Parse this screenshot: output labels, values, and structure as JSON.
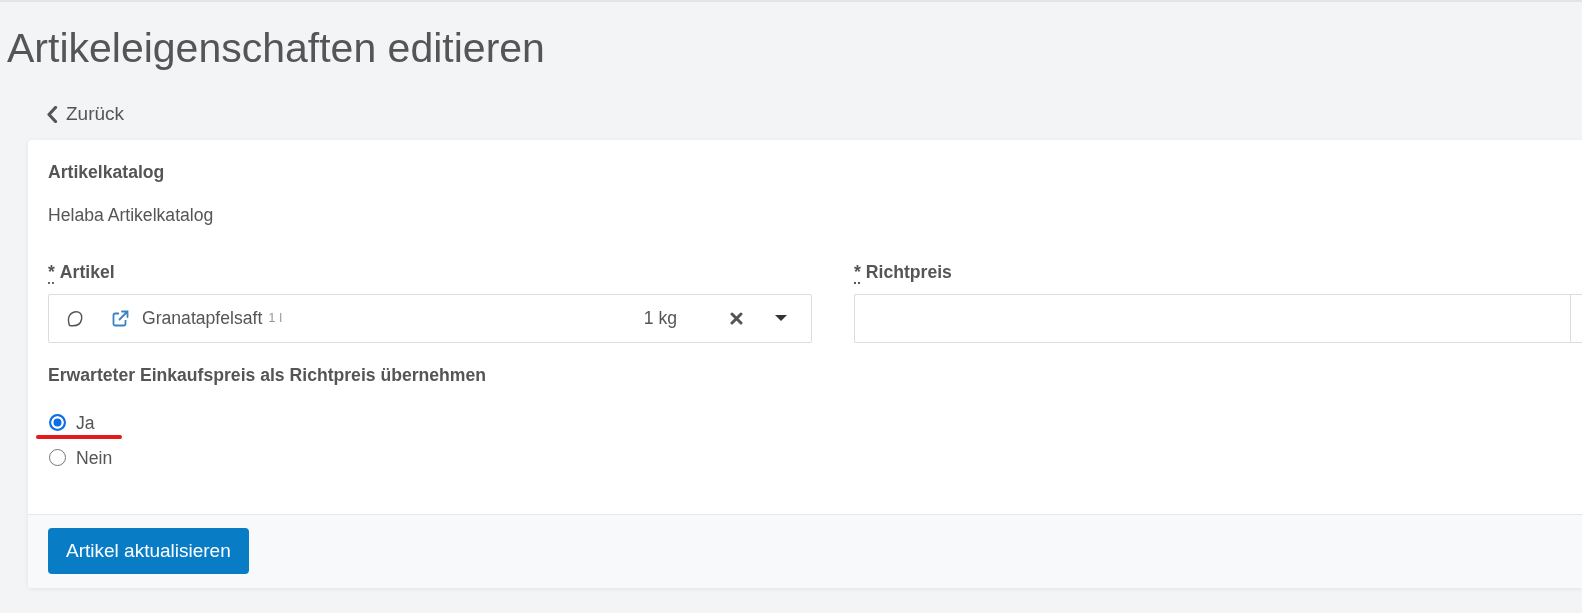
{
  "page": {
    "title": "Artikeleigenschaften editieren",
    "back_link": "Zurück"
  },
  "catalog": {
    "label": "Artikelkatalog",
    "value": "Helaba Artikelkatalog"
  },
  "article_field": {
    "required_mark": "*",
    "label": "Artikel",
    "item": {
      "name": "Granatapfelsaft",
      "unit_note": "1 l",
      "quantity": "1 kg"
    }
  },
  "price_field": {
    "required_mark": "*",
    "label": "Richtpreis"
  },
  "adopt_price": {
    "label": "Erwarteter Einkaufspreis als Richtpreis übernehmen",
    "options": [
      {
        "label": "Ja",
        "selected": true,
        "underlined": true
      },
      {
        "label": "Nein",
        "selected": false,
        "underlined": false
      }
    ]
  },
  "footer": {
    "submit_button": "Artikel aktualisieren"
  }
}
